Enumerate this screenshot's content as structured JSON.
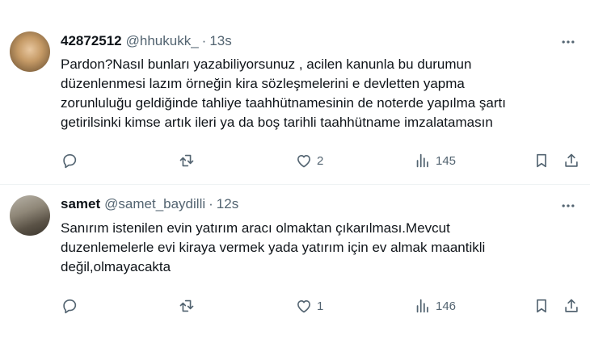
{
  "tweets": [
    {
      "name": "42872512",
      "handle": "@hhukukk_",
      "separator": "·",
      "time": "13s",
      "lines": [
        "Pardon?Nasıl bunları yazabiliyorsunuz , acilen kanunla bu durumun",
        "düzenlenmesi  lazım örneğin kira sözleşmelerini e devletten yapma",
        "zorunluluğu geldiğinde tahliye taahhütnamesinin de  noterde yapılma şartı",
        "getirilsinki kimse artık ileri ya da boş tarihli taahhütname imzalatamasın"
      ],
      "likes": "2",
      "views": "145"
    },
    {
      "name": "samet",
      "handle": "@samet_baydilli",
      "separator": "·",
      "time": "12s",
      "lines": [
        "Sanırım istenilen evin yatırım aracı olmaktan  çıkarılması.Mevcut",
        "duzenlemelerle evi kiraya vermek yada yatırım için ev almak maantikli",
        "değil,olmayacakta"
      ],
      "likes": "1",
      "views": "146"
    }
  ],
  "icons": {
    "reply": "reply-icon",
    "retweet": "retweet-icon",
    "like": "like-icon",
    "views": "views-icon",
    "bookmark": "bookmark-icon",
    "share": "share-icon",
    "more": "more-icon"
  },
  "colors": {
    "text": "#0f1419",
    "secondary": "#536471",
    "divider": "#eff3f4"
  }
}
